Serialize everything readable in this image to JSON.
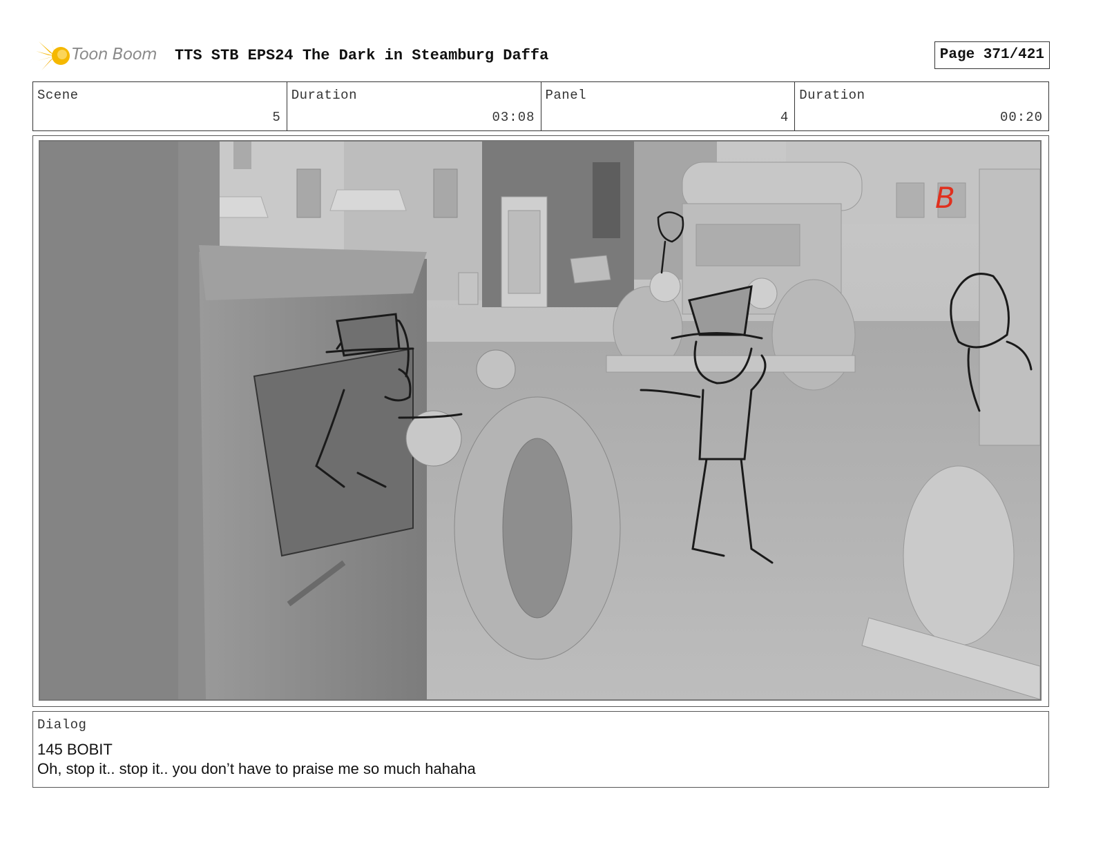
{
  "header": {
    "logo_text": "Toon Boom",
    "title": "TTS STB EPS24 The Dark in Steamburg Daffa",
    "page_indicator": "Page 371/421"
  },
  "info": {
    "scene_label": "Scene",
    "scene_value": "5",
    "scene_duration_label": "Duration",
    "scene_duration_value": "03:08",
    "panel_label": "Panel",
    "panel_value": "4",
    "panel_duration_label": "Duration",
    "panel_duration_value": "00:20"
  },
  "panel": {
    "mark": "B"
  },
  "dialog": {
    "label": "Dialog",
    "speaker": "145 BOBIT",
    "line": "Oh, stop it.. stop it.. you don’t have to praise me so much hahaha"
  },
  "colors": {
    "logo_star": "#f5b800",
    "mark_red": "#e0301e",
    "border": "#333333"
  }
}
